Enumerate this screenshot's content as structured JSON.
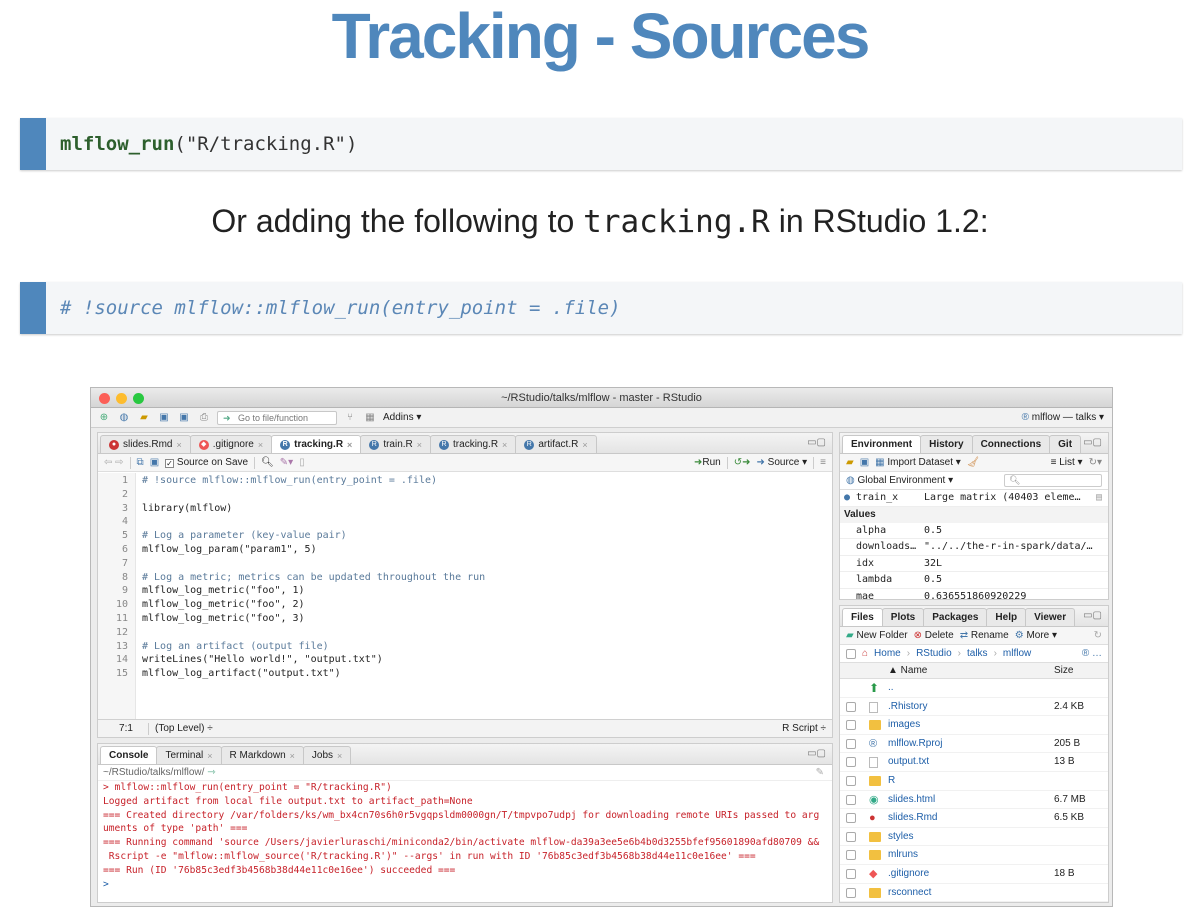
{
  "slide": {
    "title": "Tracking - Sources",
    "code1": {
      "fn": "mlflow_run",
      "args": "(\"R/tracking.R\")"
    },
    "subtitle": {
      "before": "Or adding the following to ",
      "code": "tracking.R",
      "after": " in RStudio 1.2:"
    },
    "code2": "# !source mlflow::mlflow_run(entry_point = .file)"
  },
  "window": {
    "title": "~/RStudio/talks/mlflow - master - RStudio",
    "toolbar": {
      "goto_placeholder": "Go to file/function",
      "addins": "Addins",
      "project": "mlflow — talks"
    },
    "source_tabs": [
      {
        "label": "slides.Rmd"
      },
      {
        "label": ".gitignore"
      },
      {
        "label": "tracking.R"
      },
      {
        "label": "train.R"
      },
      {
        "label": "tracking.R"
      },
      {
        "label": "artifact.R"
      }
    ],
    "editor_bar": {
      "source_on_save": "Source on Save",
      "run": "Run",
      "source": "Source"
    },
    "code_lines": [
      {
        "n": "1",
        "text": "# !source mlflow::mlflow_run(entry_point = .file)",
        "kind": "cm"
      },
      {
        "n": "2",
        "text": "",
        "kind": ""
      },
      {
        "n": "3",
        "text": "library(mlflow)",
        "kind": ""
      },
      {
        "n": "4",
        "text": "",
        "kind": ""
      },
      {
        "n": "5",
        "text": "# Log a parameter (key-value pair)",
        "kind": "cm"
      },
      {
        "n": "6",
        "text": "mlflow_log_param(\"param1\", 5)",
        "kind": ""
      },
      {
        "n": "7",
        "text": "",
        "kind": ""
      },
      {
        "n": "8",
        "text": "# Log a metric; metrics can be updated throughout the run",
        "kind": "cm"
      },
      {
        "n": "9",
        "text": "mlflow_log_metric(\"foo\", 1)",
        "kind": ""
      },
      {
        "n": "10",
        "text": "mlflow_log_metric(\"foo\", 2)",
        "kind": ""
      },
      {
        "n": "11",
        "text": "mlflow_log_metric(\"foo\", 3)",
        "kind": ""
      },
      {
        "n": "12",
        "text": "",
        "kind": ""
      },
      {
        "n": "13",
        "text": "# Log an artifact (output file)",
        "kind": "cm"
      },
      {
        "n": "14",
        "text": "writeLines(\"Hello world!\", \"output.txt\")",
        "kind": ""
      },
      {
        "n": "15",
        "text": "mlflow_log_artifact(\"output.txt\")",
        "kind": ""
      }
    ],
    "editor_status": {
      "pos": "7:1",
      "scope": "(Top Level) ÷",
      "type": "R Script ÷"
    },
    "console_tabs": [
      {
        "label": "Console"
      },
      {
        "label": "Terminal"
      },
      {
        "label": "R Markdown"
      },
      {
        "label": "Jobs"
      }
    ],
    "console_path": "~/RStudio/talks/mlflow/",
    "console_lines": [
      {
        "text": "> mlflow::mlflow_run(entry_point = \"R/tracking.R\")",
        "kind": "red"
      },
      {
        "text": "Logged artifact from local file output.txt to artifact_path=None",
        "kind": "red"
      },
      {
        "text": "=== Created directory /var/folders/ks/wm_bx4cn70s6h0r5vgqpsldm0000gn/T/tmpvpo7udpj for downloading remote URIs passed to arg",
        "kind": "red"
      },
      {
        "text": "uments of type 'path' ===",
        "kind": "red"
      },
      {
        "text": "=== Running command 'source /Users/javierluraschi/miniconda2/bin/activate mlflow-da39a3ee5e6b4b0d3255bfef95601890afd80709 &&",
        "kind": "red"
      },
      {
        "text": " Rscript -e \"mlflow::mlflow_source('R/tracking.R')\" --args' in run with ID '76b85c3edf3b4568b38d44e11c0e16ee' ===",
        "kind": "red"
      },
      {
        "text": "=== Run (ID '76b85c3edf3b4568b38d44e11c0e16ee') succeeded ===",
        "kind": "red"
      },
      {
        "text": "> ",
        "kind": "prompt"
      }
    ],
    "env_tabs": [
      {
        "label": "Environment"
      },
      {
        "label": "History"
      },
      {
        "label": "Connections"
      },
      {
        "label": "Git"
      }
    ],
    "env_bar": {
      "import": "Import Dataset",
      "list": "List",
      "global": "Global Environment"
    },
    "env_data_row": {
      "name": "train_x",
      "value": "Large matrix (40403 eleme…"
    },
    "values_header": "Values",
    "env_values": [
      {
        "k": "alpha",
        "v": "0.5"
      },
      {
        "k": "downloads…",
        "v": "\"../../the-r-in-spark/data/…"
      },
      {
        "k": "idx",
        "v": "32L"
      },
      {
        "k": "lambda",
        "v": "0.5"
      },
      {
        "k": "mae",
        "v": "0.636551860920229"
      }
    ],
    "files_tabs": [
      {
        "label": "Files"
      },
      {
        "label": "Plots"
      },
      {
        "label": "Packages"
      },
      {
        "label": "Help"
      },
      {
        "label": "Viewer"
      }
    ],
    "files_bar": {
      "new_folder": "New Folder",
      "delete": "Delete",
      "rename": "Rename",
      "more": "More"
    },
    "breadcrumb": [
      "Home",
      "RStudio",
      "talks",
      "mlflow"
    ],
    "files_header": {
      "name": "▲ Name",
      "size": "Size"
    },
    "files": [
      {
        "name": "..",
        "size": "",
        "type": "up"
      },
      {
        "name": ".Rhistory",
        "size": "2.4 KB",
        "type": "file"
      },
      {
        "name": "images",
        "size": "",
        "type": "folder"
      },
      {
        "name": "mlflow.Rproj",
        "size": "205 B",
        "type": "rproj"
      },
      {
        "name": "output.txt",
        "size": "13 B",
        "type": "file"
      },
      {
        "name": "R",
        "size": "",
        "type": "folder"
      },
      {
        "name": "slides.html",
        "size": "6.7 MB",
        "type": "html"
      },
      {
        "name": "slides.Rmd",
        "size": "6.5 KB",
        "type": "rmd"
      },
      {
        "name": "styles",
        "size": "",
        "type": "folder"
      },
      {
        "name": "mlruns",
        "size": "",
        "type": "folder"
      },
      {
        "name": ".gitignore",
        "size": "18 B",
        "type": "git"
      },
      {
        "name": "rsconnect",
        "size": "",
        "type": "folder"
      }
    ]
  }
}
